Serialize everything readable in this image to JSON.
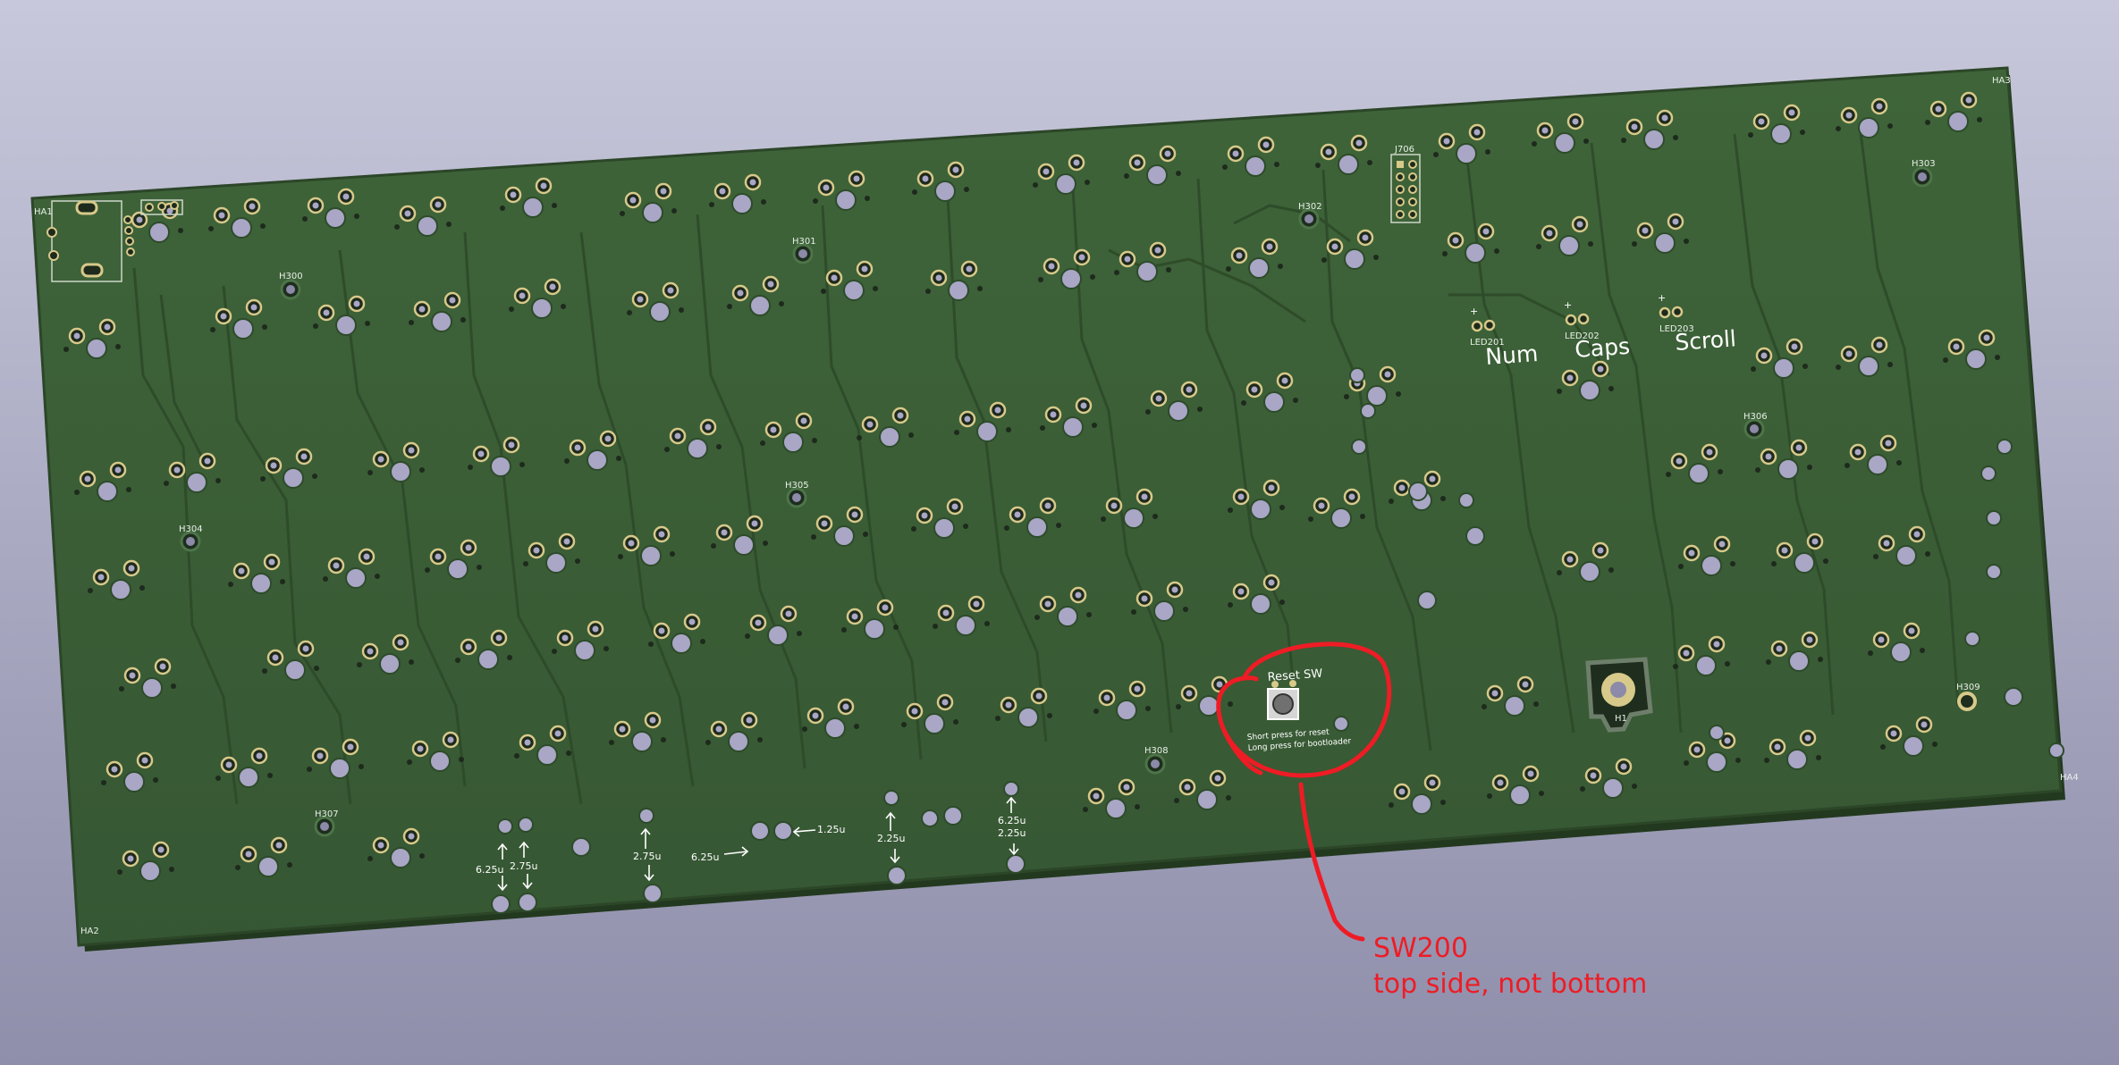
{
  "labels": {
    "refs": {
      "ha1": "HA1",
      "ha2": "HA2",
      "ha3": "HA3",
      "ha4": "HA4",
      "h1": "H1",
      "h300": "H300",
      "h301": "H301",
      "h302": "H302",
      "h303": "H303",
      "h304": "H304",
      "h305": "H305",
      "h306": "H306",
      "h307": "H307",
      "h308": "H308",
      "h309": "H309",
      "j706": "J706",
      "led201": "LED201",
      "led202": "LED202",
      "led203": "LED203"
    },
    "leds": {
      "num": "Num",
      "caps": "Caps",
      "scroll": "Scroll"
    },
    "sizes": {
      "s1": "6.25u",
      "s2": "2.75u",
      "s3": "2.75u",
      "s4": "6.25u",
      "s5": "1.25u",
      "s6": "2.25u",
      "s7": "6.25u",
      "s8": "2.25u"
    },
    "reset": {
      "title": "Reset SW",
      "line1": "Short press for reset",
      "line2": "Long press for bootloader"
    }
  },
  "annotation": {
    "line1": "SW200",
    "line2": "top side, not bottom",
    "color": "#ee1c25"
  },
  "colors": {
    "board": "#3b5e38",
    "edge": "#23391f",
    "hole": "#a9a6c6",
    "pad": "#d7c98a",
    "trace": "#34552f"
  }
}
